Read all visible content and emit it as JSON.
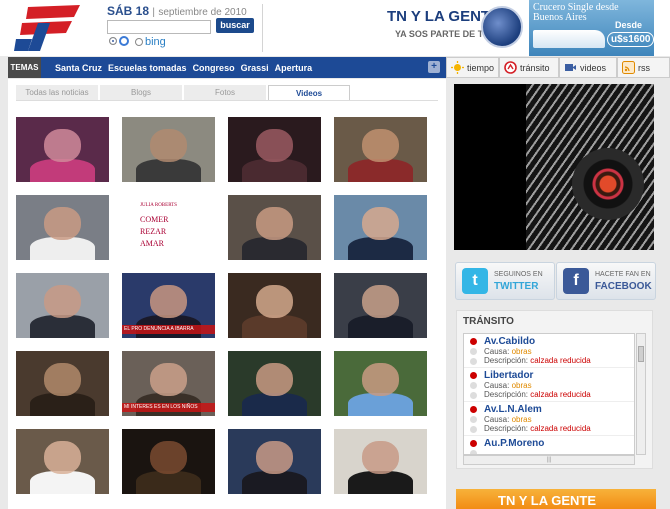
{
  "header": {
    "logo": "TN",
    "day": "SÁB 18",
    "date": "septiembre de 2010",
    "search": {
      "placeholder": "",
      "button": "buscar"
    },
    "engines": [
      "",
      "bing"
    ],
    "banner_tn": {
      "title": "TN Y LA GENTE",
      "subtitle": "YA SOS PARTE DE TN"
    },
    "banner_crucero": {
      "line1": "Crucero Single desde",
      "line2": "Buenos Aires",
      "desde": "Desde",
      "price": "u$s1600"
    }
  },
  "nav": {
    "label": "TEMAS",
    "topics": [
      "Santa Cruz",
      "Escuelas tomadas",
      "Congreso",
      "Grassi",
      "Apertura"
    ],
    "more": "+"
  },
  "tools": [
    {
      "label": "tiempo",
      "icon": "sun-icon"
    },
    {
      "label": "tránsito",
      "icon": "traffic-icon"
    },
    {
      "label": "videos",
      "icon": "video-icon"
    },
    {
      "label": "rss",
      "icon": "rss-icon"
    }
  ],
  "tabs": [
    "Todas las noticias",
    "Blogs",
    "Fotos",
    "Videos"
  ],
  "active_tab": "Videos",
  "thumbs": [
    {
      "bg": "#5a2a4a",
      "face": "#d08a9a",
      "body": "#c23b7a",
      "cap": ""
    },
    {
      "bg": "#8c8a80",
      "face": "#b08a70",
      "body": "#3a3a3a",
      "cap": ""
    },
    {
      "bg": "#2a1a1e",
      "face": "#9a5a62",
      "body": "#4a2a30",
      "cap": ""
    },
    {
      "bg": "#6a5a48",
      "face": "#c09070",
      "body": "#8a2a2a",
      "cap": ""
    },
    {
      "bg": "#7a7e86",
      "face": "#c99a84",
      "body": "#eeeeee",
      "cap": ""
    },
    {
      "bg": "#ffffff",
      "face": "",
      "body": "",
      "cap": "",
      "book": [
        "JULIA ROBERTS",
        "COMER",
        "REZAR",
        "AMAR"
      ]
    },
    {
      "bg": "#5a5048",
      "face": "#c89a82",
      "body": "#2a2a30",
      "cap": ""
    },
    {
      "bg": "#6a8aa8",
      "face": "#d6a88e",
      "body": "#1c2a44",
      "cap": ""
    },
    {
      "bg": "#9aa0a8",
      "face": "#c89a86",
      "body": "#2a2e38",
      "cap": ""
    },
    {
      "bg": "#2a3a6a",
      "face": "#c89680",
      "body": "#1a1a2a",
      "cap": "EL PRO DENUNCIA A IBARRA"
    },
    {
      "bg": "#3a2a20",
      "face": "#d2a88c",
      "body": "#5a3a2a",
      "cap": ""
    },
    {
      "bg": "#3a3e48",
      "face": "#c8a08a",
      "body": "#1a1e2a",
      "cap": ""
    },
    {
      "bg": "#4a3a2e",
      "face": "#b08a6a",
      "body": "#2a2018",
      "cap": ""
    },
    {
      "bg": "#6a6058",
      "face": "#caa08a",
      "body": "#3a3028",
      "cap": "MI INTERES ES EN LOS NIÑOS"
    },
    {
      "bg": "#2a3a2a",
      "face": "#c89a82",
      "body": "#1a2a4a",
      "cap": ""
    },
    {
      "bg": "#4a6a3a",
      "face": "#c89a82",
      "body": "#6aa0d8",
      "cap": ""
    },
    {
      "bg": "#6a5a4a",
      "face": "#d8b098",
      "body": "#f4f4f4",
      "cap": ""
    },
    {
      "bg": "#1a1410",
      "face": "#7a4a30",
      "body": "#3a2a1a",
      "cap": ""
    },
    {
      "bg": "#2a3a5a",
      "face": "#c89a86",
      "body": "#1a1a22",
      "cap": ""
    },
    {
      "bg": "#d8d4cc",
      "face": "#c89a86",
      "body": "#1a1a1a",
      "cap": ""
    }
  ],
  "social": {
    "twitter": {
      "line1": "SEGUINOS EN",
      "line2": "TWITTER",
      "icon": "t"
    },
    "facebook": {
      "line1": "HACETE FAN EN",
      "line2": "FACEBOOK",
      "icon": "f"
    }
  },
  "transit": {
    "title": "TRÁNSITO",
    "cause_label": "Causa:",
    "desc_label": "Descripción:",
    "items": [
      {
        "name": "Av.Cabildo",
        "cause": "obras",
        "desc": "calzada reducida"
      },
      {
        "name": "Libertador",
        "cause": "obras",
        "desc": "calzada reducida"
      },
      {
        "name": "Av.L.N.Alem",
        "cause": "obras",
        "desc": "calzada reducida"
      },
      {
        "name": "Au.P.Moreno",
        "cause": "",
        "desc": ""
      }
    ],
    "hscroll": "|||"
  },
  "banner_bottom": "TN Y LA GENTE"
}
